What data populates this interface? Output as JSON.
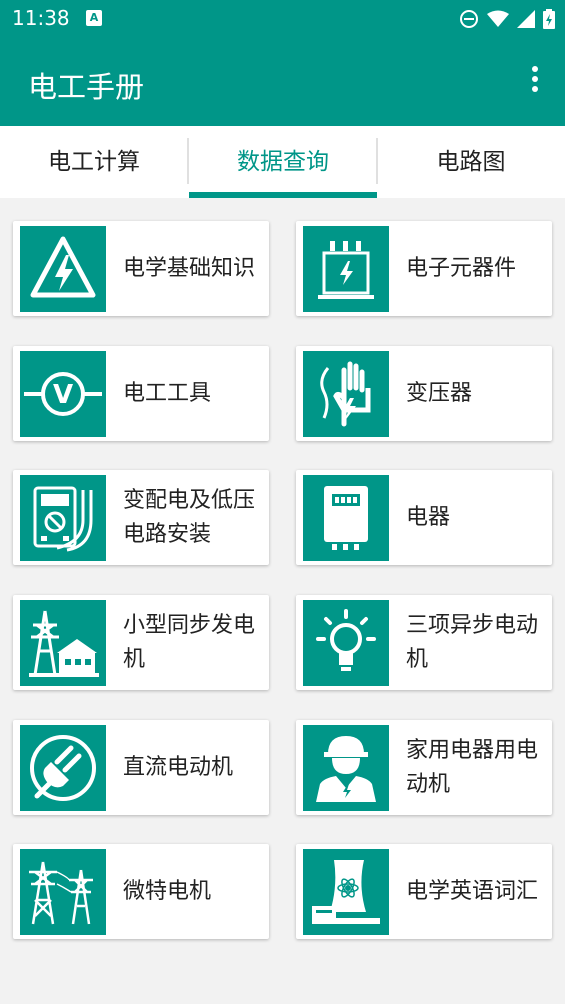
{
  "status_bar": {
    "time": "11:38",
    "notif_glyph": "A"
  },
  "app_bar": {
    "title": "电工手册",
    "menu_icon": "more-vert-icon"
  },
  "tabs": [
    {
      "label": "电工计算",
      "active": false
    },
    {
      "label": "数据查询",
      "active": true
    },
    {
      "label": "电路图",
      "active": false
    }
  ],
  "accent_color": "#009688",
  "items": [
    {
      "label": "电学基础知识",
      "icon": "high-voltage-warning-icon"
    },
    {
      "label": "电子元器件",
      "icon": "transformer-component-icon"
    },
    {
      "label": "电工工具",
      "icon": "voltmeter-icon"
    },
    {
      "label": "变压器",
      "icon": "electric-hand-icon"
    },
    {
      "label": "变配电及低压电路安装",
      "icon": "multimeter-icon"
    },
    {
      "label": "电器",
      "icon": "electric-box-icon"
    },
    {
      "label": "小型同步发电机",
      "icon": "power-tower-house-icon"
    },
    {
      "label": "三项异步电动机",
      "icon": "light-bulb-icon"
    },
    {
      "label": "直流电动机",
      "icon": "plug-icon"
    },
    {
      "label": "家用电器用电动机",
      "icon": "electrician-icon"
    },
    {
      "label": "微特电机",
      "icon": "power-towers-icon"
    },
    {
      "label": "电学英语词汇",
      "icon": "nuclear-plant-icon"
    }
  ]
}
